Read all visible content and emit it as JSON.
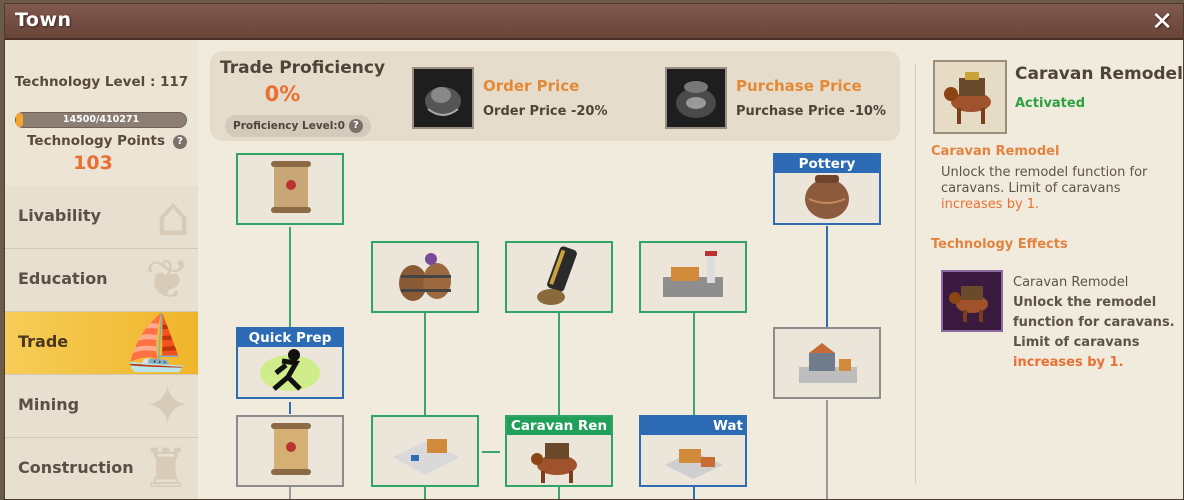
{
  "window": {
    "title": "Town",
    "close_label": "✕"
  },
  "sidebar": {
    "tech_level": "Technology Level : 117",
    "progress_text": "14500/410271",
    "progress_fraction": 0.0353,
    "tech_points_label": "Technology Points",
    "tech_points_value": "103",
    "help": "?",
    "tabs": [
      {
        "label": "Livability",
        "active": false
      },
      {
        "label": "Education",
        "active": false
      },
      {
        "label": "Trade",
        "active": true
      },
      {
        "label": "Mining",
        "active": false
      },
      {
        "label": "Construction",
        "active": false
      }
    ]
  },
  "banner": {
    "title": "Trade Proficiency",
    "percent": "0%",
    "level": "Proficiency Level:0",
    "bonuses": [
      {
        "title": "Order Price",
        "desc": "Order Price -20%"
      },
      {
        "title": "Purchase Price",
        "desc": "Purchase Price -10%"
      }
    ]
  },
  "tree": {
    "nodes": [
      {
        "id": "scroll-1",
        "header": "",
        "icon": "scroll-icon"
      },
      {
        "id": "barrels",
        "header": "",
        "icon": "barrels-icon"
      },
      {
        "id": "telescope",
        "header": "",
        "icon": "telescope-icon"
      },
      {
        "id": "port",
        "header": "",
        "icon": "port-icon"
      },
      {
        "id": "pottery",
        "header": "Pottery",
        "icon": "pottery-icon"
      },
      {
        "id": "quick-prep",
        "header": "Quick Prep",
        "icon": "running-man-icon"
      },
      {
        "id": "market-town",
        "header": "",
        "icon": "town-icon"
      },
      {
        "id": "scroll-2",
        "header": "",
        "icon": "scroll-icon"
      },
      {
        "id": "warehouse",
        "header": "",
        "icon": "warehouse-icon"
      },
      {
        "id": "caravan-remodel",
        "header": "Caravan Ren",
        "icon": "caravan-icon"
      },
      {
        "id": "water",
        "header": "Wat",
        "icon": "house-icon"
      }
    ]
  },
  "detail": {
    "title": "Caravan Remodel",
    "status": "Activated",
    "section1_heading": "Caravan Remodel",
    "section1_line1": "Unlock the remodel function for",
    "section1_line2": "caravans. Limit of caravans",
    "section1_line3": "increases by 1.",
    "section2_heading": "Technology Effects",
    "effect_name": "Caravan Remodel",
    "effect_line1": "Unlock the remodel",
    "effect_line2": "function for caravans.",
    "effect_line3": "Limit of caravans",
    "effect_line4": "increases by 1."
  }
}
